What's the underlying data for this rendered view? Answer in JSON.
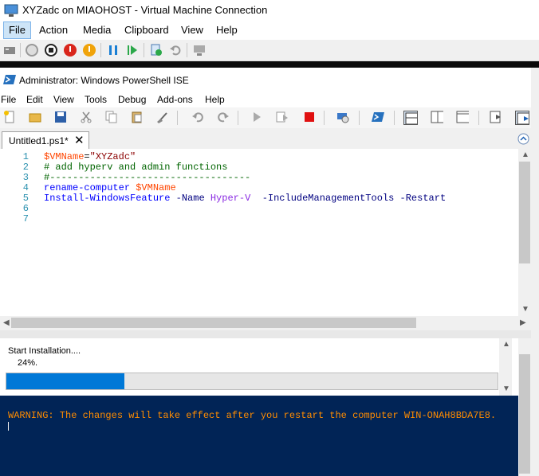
{
  "vm_window": {
    "title": "XYZadc on MIAOHOST - Virtual Machine Connection",
    "menu": [
      "File",
      "Action",
      "Media",
      "Clipboard",
      "View",
      "Help"
    ]
  },
  "ise_window": {
    "title": "Administrator: Windows PowerShell ISE",
    "menu": [
      "File",
      "Edit",
      "View",
      "Tools",
      "Debug",
      "Add-ons",
      "Help"
    ],
    "tab_label": "Untitled1.ps1*",
    "tab_close": "✕"
  },
  "editor": {
    "line_numbers": [
      "1",
      "2",
      "3",
      "4",
      "5",
      "6",
      "7"
    ],
    "line1_var": "$VMName",
    "line1_eq": "=",
    "line1_str": "\"XYZadc\"",
    "line2": "# add hyperv and admin functions",
    "line3": "#-----------------------------------",
    "line4_cmd": "rename-computer",
    "line4_var": "$VMName",
    "line5_cmd": "Install-WindowsFeature",
    "line5_p1": "-Name",
    "line5_a1": "Hyper-V",
    "line5_p2": "-IncludeManagementTools",
    "line5_p3": "-Restart"
  },
  "console": {
    "progress_title": "Start Installation....",
    "progress_text": "24%.",
    "progress_value": 0.24,
    "warning": "WARNING: The changes will take effect after you restart the computer WIN-ONAH8BDA7E8."
  },
  "colors": {
    "console_bg": "#012456",
    "warning": "#ff8c00",
    "progress": "#0078d7"
  }
}
